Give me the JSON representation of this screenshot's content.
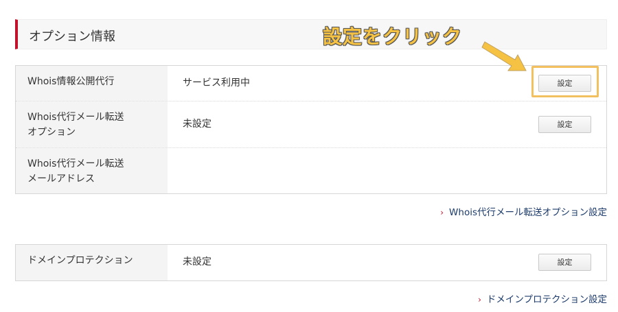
{
  "section": {
    "title": "オプション情報"
  },
  "whois_table": {
    "rows": [
      {
        "label": "Whois情報公開代行",
        "value": "サービス利用中",
        "button": "設定"
      },
      {
        "label_line1": "Whois代行メール転送",
        "label_line2": "オプション",
        "value": "未設定",
        "button": "設定"
      },
      {
        "label_line1": "Whois代行メール転送",
        "label_line2": "メールアドレス",
        "value": ""
      }
    ]
  },
  "whois_link": {
    "chevron": "›",
    "text": "Whois代行メール転送オプション設定"
  },
  "protection_table": {
    "rows": [
      {
        "label": "ドメインプロテクション",
        "value": "未設定",
        "button": "設定"
      }
    ]
  },
  "protection_link": {
    "chevron": "›",
    "text": "ドメインプロテクション設定"
  },
  "annotation": {
    "text": "設定をクリック",
    "color": "#f6c244"
  },
  "colors": {
    "accent": "#c3112b",
    "link": "#1c3b6a",
    "highlight": "#f3c060"
  }
}
